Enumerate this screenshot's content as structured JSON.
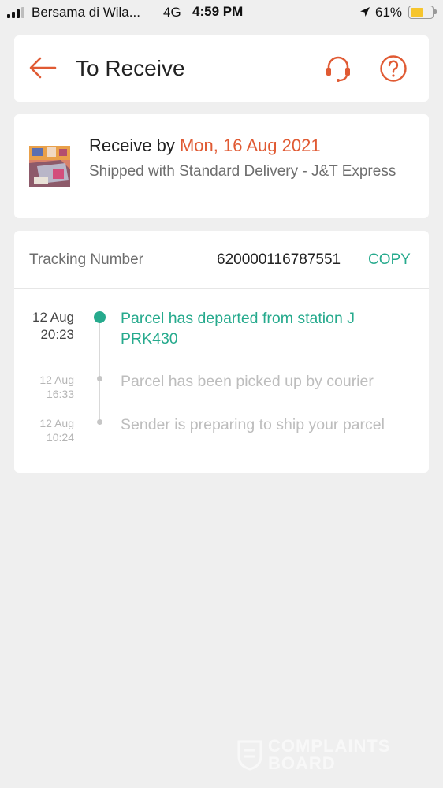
{
  "status_bar": {
    "carrier": "Bersama di Wila...",
    "network": "4G",
    "time": "4:59 PM",
    "battery": "61%",
    "battery_color": "#f6c52d"
  },
  "header": {
    "title": "To Receive",
    "back_icon": "arrow-left-icon",
    "support_icon": "headset-icon",
    "help_icon": "question-circle-icon",
    "accent": "#e05a33"
  },
  "delivery": {
    "receive_prefix": "Receive by",
    "receive_date": "Mon, 16 Aug 2021",
    "shipping": "Shipped with Standard Delivery  - J&T Express"
  },
  "tracking": {
    "label": "Tracking Number",
    "number": "620000116787551",
    "copy_label": "COPY",
    "accent": "#26aa8d",
    "events": [
      {
        "date": "12 Aug",
        "time": "20:23",
        "text": "Parcel has departed from station J PRK430"
      },
      {
        "date": "12 Aug",
        "time": "16:33",
        "text": "Parcel has been picked up by courier"
      },
      {
        "date": "12 Aug",
        "time": "10:24",
        "text": "Sender is preparing to ship your parcel"
      }
    ]
  },
  "watermark": {
    "line1": "COMPLAINTS",
    "line2": "BOARD"
  }
}
